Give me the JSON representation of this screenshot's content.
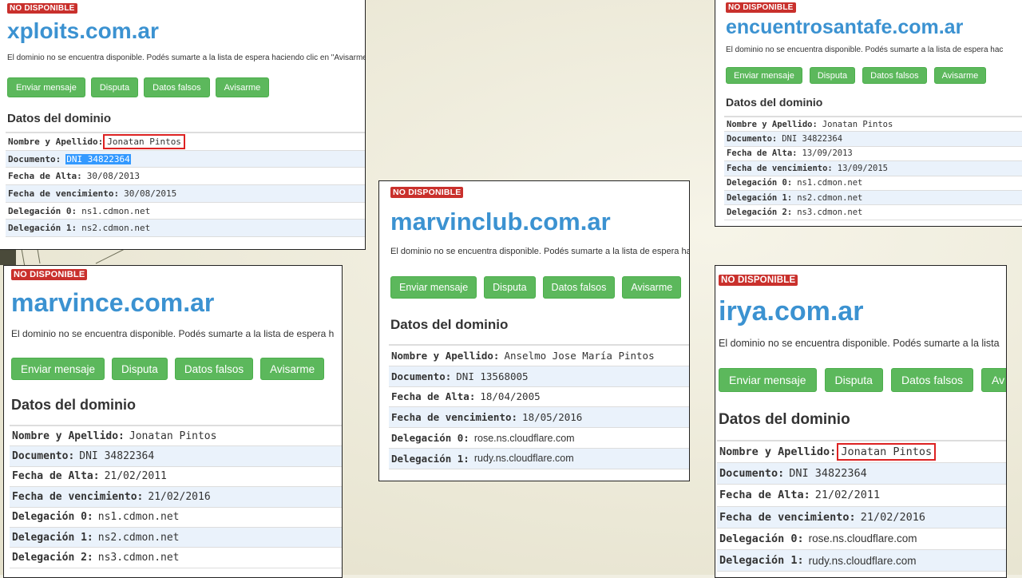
{
  "panels": [
    {
      "badge": "NO DISPONIBLE",
      "domain": "xploits.com.ar",
      "message": "El dominio no se encuentra disponible. Podés sumarte a la lista de espera haciendo clic en \"Avisarme\".",
      "buttons": [
        "Enviar mensaje",
        "Disputa",
        "Datos falsos",
        "Avisarme"
      ],
      "section_title": "Datos del dominio",
      "rows": [
        {
          "label": "Nombre y Apellido:",
          "value": "Jonatan Pintos"
        },
        {
          "label": "Documento:",
          "value": "DNI 34822364"
        },
        {
          "label": "Fecha de Alta:",
          "value": "30/08/2013"
        },
        {
          "label": "Fecha de vencimiento:",
          "value": "30/08/2015"
        },
        {
          "label": "Delegación 0:",
          "value": "ns1.cdmon.net"
        },
        {
          "label": "Delegación 1:",
          "value": "ns2.cdmon.net"
        }
      ]
    },
    {
      "badge": "NO DISPONIBLE",
      "domain": "encuentrosantafe.com.ar",
      "message": "El dominio no se encuentra disponible. Podés sumarte a la lista de espera hac",
      "buttons": [
        "Enviar mensaje",
        "Disputa",
        "Datos falsos",
        "Avisarme"
      ],
      "section_title": "Datos del dominio",
      "rows": [
        {
          "label": "Nombre y Apellido:",
          "value": "Jonatan Pintos"
        },
        {
          "label": "Documento:",
          "value": "DNI 34822364"
        },
        {
          "label": "Fecha de Alta:",
          "value": "13/09/2013"
        },
        {
          "label": "Fecha de vencimiento:",
          "value": "13/09/2015"
        },
        {
          "label": "Delegación 0:",
          "value": "ns1.cdmon.net"
        },
        {
          "label": "Delegación 1:",
          "value": "ns2.cdmon.net"
        },
        {
          "label": "Delegación 2:",
          "value": "ns3.cdmon.net"
        }
      ]
    },
    {
      "badge": "NO DISPONIBLE",
      "domain": "marvinclub.com.ar",
      "message": "El dominio no se encuentra disponible. Podés sumarte a la lista de espera hac",
      "buttons": [
        "Enviar mensaje",
        "Disputa",
        "Datos falsos",
        "Avisarme"
      ],
      "section_title": "Datos del dominio",
      "rows": [
        {
          "label": "Nombre y Apellido:",
          "value": "Anselmo Jose María Pintos"
        },
        {
          "label": "Documento:",
          "value": "DNI 13568005"
        },
        {
          "label": "Fecha de Alta:",
          "value": "18/04/2005"
        },
        {
          "label": "Fecha de vencimiento:",
          "value": "18/05/2016"
        },
        {
          "label": "Delegación 0:",
          "value": "rose.ns.cloudflare.com"
        },
        {
          "label": "Delegación 1:",
          "value": "rudy.ns.cloudflare.com"
        }
      ]
    },
    {
      "badge": "NO DISPONIBLE",
      "domain": "marvince.com.ar",
      "message": "El dominio no se encuentra disponible. Podés sumarte a la lista de espera h",
      "buttons": [
        "Enviar mensaje",
        "Disputa",
        "Datos falsos",
        "Avisarme"
      ],
      "section_title": "Datos del dominio",
      "rows": [
        {
          "label": "Nombre y Apellido:",
          "value": "Jonatan Pintos"
        },
        {
          "label": "Documento:",
          "value": "DNI 34822364"
        },
        {
          "label": "Fecha de Alta:",
          "value": "21/02/2011"
        },
        {
          "label": "Fecha de vencimiento:",
          "value": "21/02/2016"
        },
        {
          "label": "Delegación 0:",
          "value": "ns1.cdmon.net"
        },
        {
          "label": "Delegación 1:",
          "value": "ns2.cdmon.net"
        },
        {
          "label": "Delegación 2:",
          "value": "ns3.cdmon.net"
        }
      ]
    },
    {
      "badge": "NO DISPONIBLE",
      "domain": "irya.com.ar",
      "message": "El dominio no se encuentra disponible. Podés sumarte a la lista",
      "buttons": [
        "Enviar mensaje",
        "Disputa",
        "Datos falsos",
        "Av"
      ],
      "section_title": "Datos del dominio",
      "rows": [
        {
          "label": "Nombre y Apellido:",
          "value": "Jonatan Pintos"
        },
        {
          "label": "Documento:",
          "value": "DNI 34822364"
        },
        {
          "label": "Fecha de Alta:",
          "value": "21/02/2011"
        },
        {
          "label": "Fecha de vencimiento:",
          "value": "21/02/2016"
        },
        {
          "label": "Delegación 0:",
          "value": "rose.ns.cloudflare.com"
        },
        {
          "label": "Delegación 1:",
          "value": "rudy.ns.cloudflare.com"
        }
      ]
    }
  ],
  "colors": {
    "badge": "#c9302c",
    "domain": "#3b92d1",
    "button": "#5cb85c",
    "row_alt": "#eaf2fb",
    "highlight_box": "#dd2222",
    "selection": "#3399ff"
  }
}
